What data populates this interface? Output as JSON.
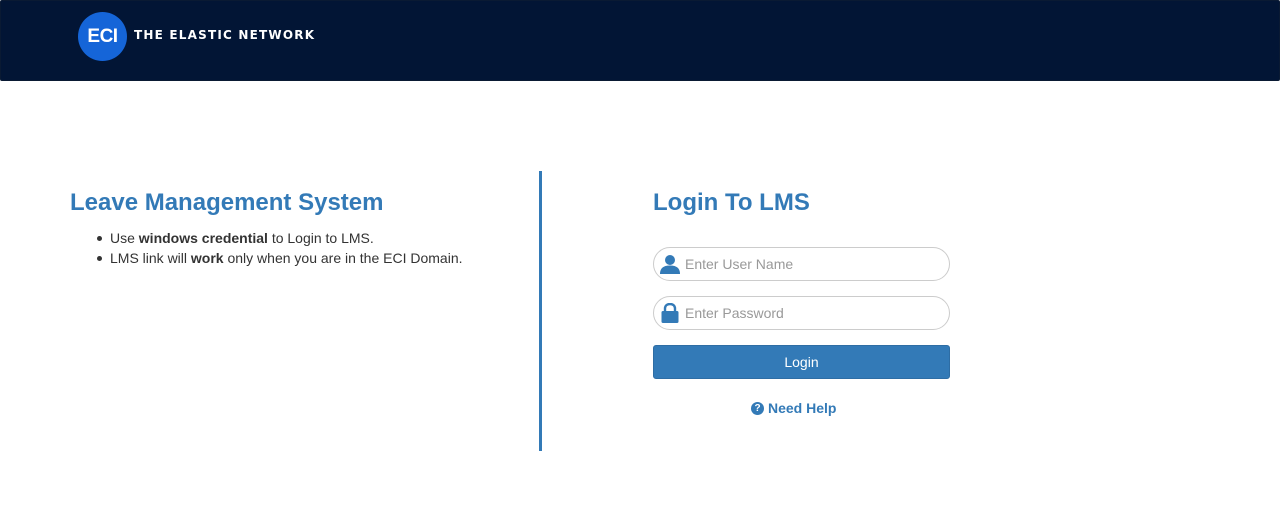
{
  "header": {
    "logo_mark": "ECI",
    "logo_text": "THE ELASTIC NETWORK",
    "background_color": "#021535",
    "logo_color": "#1565d8"
  },
  "info": {
    "title": "Leave Management System",
    "bullets": [
      {
        "pre": "Use ",
        "bold": "windows credential",
        "post": " to Login to LMS."
      },
      {
        "pre": "LMS link will ",
        "bold": "work",
        "post": " only when you are in the ECI Domain."
      }
    ]
  },
  "login": {
    "title": "Login To LMS",
    "username_placeholder": "Enter User Name",
    "username_icon": "user-icon",
    "password_placeholder": "Enter Password",
    "password_icon": "lock-icon",
    "button_label": "Login",
    "help_label": "Need Help",
    "help_icon": "question-circle-icon",
    "accent_color": "#337ab7"
  }
}
